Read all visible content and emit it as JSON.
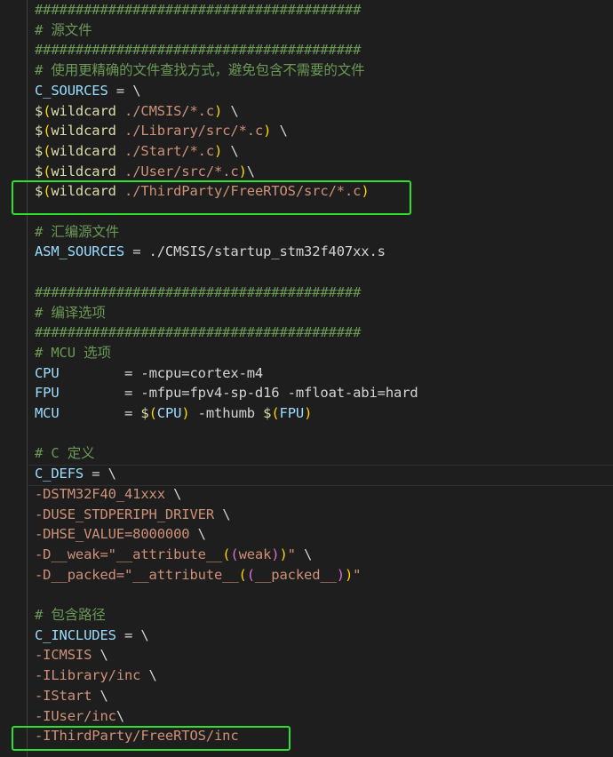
{
  "editor": {
    "lines": [
      "########################################",
      "# 源文件",
      "########################################",
      "# 使用更精确的文件查找方式，避免包含不需要的文件",
      "C_SOURCES = \\",
      "$(wildcard ./CMSIS/*.c) \\",
      "$(wildcard ./Library/src/*.c) \\",
      "$(wildcard ./Start/*.c) \\",
      "$(wildcard ./User/src/*.c)\\",
      "$(wildcard ./ThirdParty/FreeRTOS/src/*.c)",
      "",
      "# 汇编源文件",
      "ASM_SOURCES = ./CMSIS/startup_stm32f407xx.s",
      "",
      "########################################",
      "# 编译选项",
      "########################################",
      "# MCU 选项",
      "CPU        = -mcpu=cortex-m4",
      "FPU        = -mfpu=fpv4-sp-d16 -mfloat-abi=hard",
      "MCU        = $(CPU) -mthumb $(FPU)",
      "",
      "# C 定义",
      "C_DEFS = \\",
      "-DSTM32F40_41xxx \\",
      "-DUSE_STDPERIPH_DRIVER \\",
      "-DHSE_VALUE=8000000 \\",
      "-D__weak=\"__attribute__((weak))\" \\",
      "-D__packed=\"__attribute__((__packed__))\"",
      "",
      "# 包含路径",
      "C_INCLUDES = \\",
      "-ICMSIS \\",
      "-ILibrary/inc \\",
      "-IStart \\",
      "-IUser/inc\\",
      "-IThirdParty/FreeRTOS/inc"
    ],
    "highlight_color": "#2ee02e"
  }
}
